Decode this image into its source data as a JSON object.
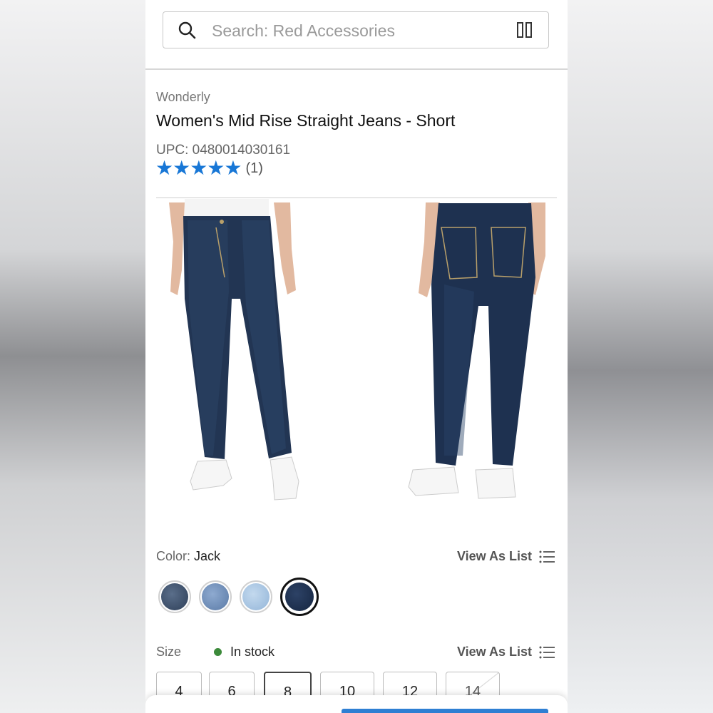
{
  "search": {
    "placeholder": "Search: Red Accessories"
  },
  "product": {
    "brand": "Wonderly",
    "title": "Women's Mid Rise Straight Jeans - Short",
    "upc": "UPC: 0480014030161",
    "rating": {
      "stars": "★★★★★",
      "review_count": "(1)",
      "value": 5
    }
  },
  "color": {
    "label": "Color:",
    "selected": "Jack",
    "view_as_list": "View As List",
    "swatches": [
      {
        "name": "dark-wash",
        "color": "#3c4e68"
      },
      {
        "name": "medium-wash",
        "color": "#6f8fb8"
      },
      {
        "name": "light-wash",
        "color": "#a9c7e3"
      },
      {
        "name": "jack",
        "color": "#1f3150",
        "selected": true
      }
    ]
  },
  "size": {
    "label": "Size",
    "stock_status": "In stock",
    "view_as_list": "View As List",
    "options": [
      "4",
      "6",
      "8",
      "10",
      "12",
      "14"
    ],
    "selected": "8",
    "unavailable": [
      "14"
    ]
  },
  "colors": {
    "star": "#1877d6",
    "in_stock": "#3c8a3a",
    "accent": "#2f7fd3"
  }
}
